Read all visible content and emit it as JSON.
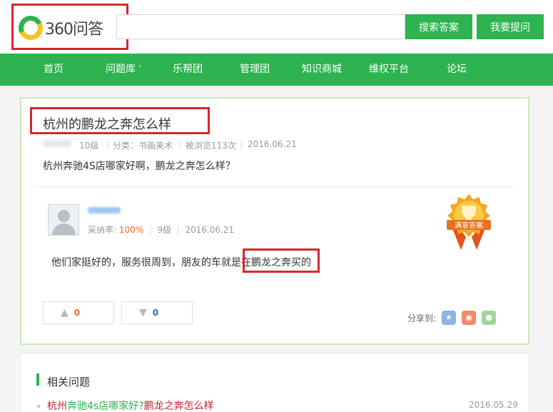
{
  "header": {
    "logo_text": "360问答",
    "search_placeholder": "",
    "search_button": "搜索答案",
    "ask_button": "我要提问"
  },
  "nav": {
    "items": [
      {
        "label": "首页"
      },
      {
        "label": "问题库"
      },
      {
        "label": "乐帮团"
      },
      {
        "label": "管理团"
      },
      {
        "label": "知识商城"
      },
      {
        "label": "维权平台"
      },
      {
        "label": "论坛"
      }
    ]
  },
  "question": {
    "title": "杭州的鹏龙之奔怎么样",
    "level": "10级",
    "category": "分类：书画美术",
    "views": "被浏览113次",
    "date": "2016.06.21",
    "description": "杭州奔驰4S店哪家好啊，鹏龙之奔怎么样？"
  },
  "answer": {
    "accept_label": "采纳率:",
    "accept_rate": "100%",
    "level": "9级",
    "date": "2016.06.21",
    "text": "他们家挺好的，服务很周到，朋友的车就是在鹏龙之奔买的",
    "badge_text": "满意答案",
    "likes": "0",
    "dislikes": "0",
    "share_label": "分享到:"
  },
  "related": {
    "title": "相关问题",
    "items": [
      {
        "part1": "杭州",
        "part2": "奔驰4s店哪家好?",
        "part3": "鹏龙之奔怎么样",
        "date": "2016.05.29"
      }
    ]
  },
  "colors": {
    "brand_green": "#2db34f",
    "highlight_red": "#d9262c",
    "accept_orange": "#f06a2a"
  }
}
